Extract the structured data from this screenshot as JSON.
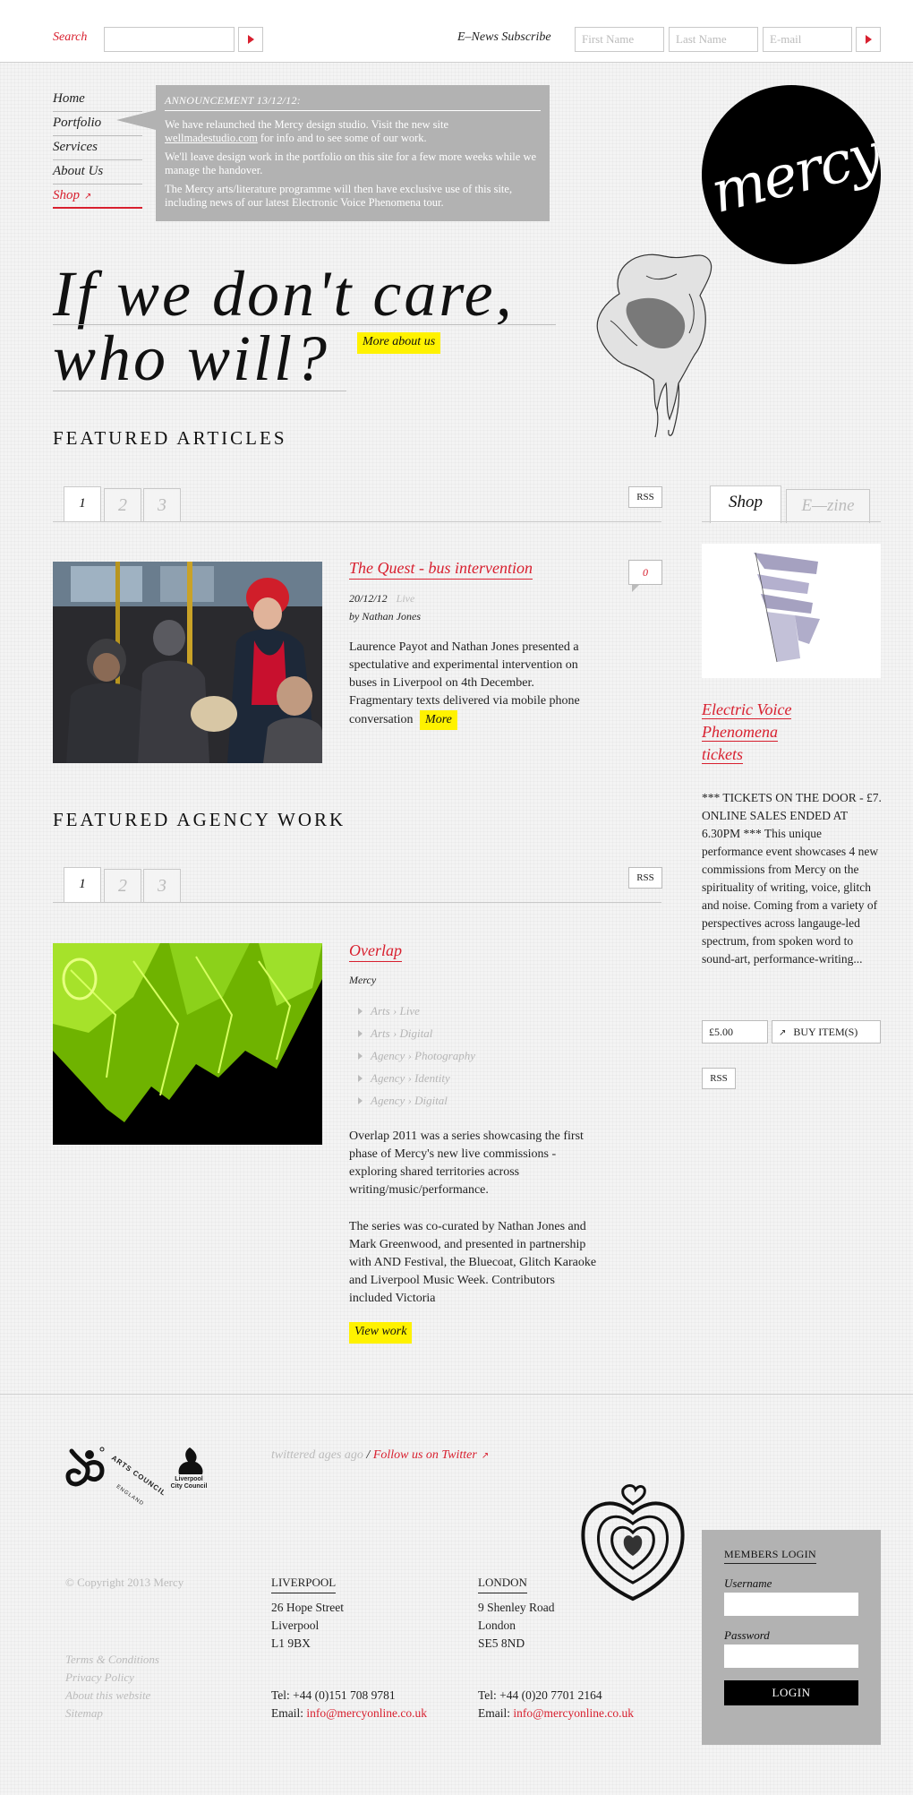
{
  "topbar": {
    "search_label": "Search",
    "enews_label": "E–News Subscribe",
    "first_name_placeholder": "First Name",
    "last_name_placeholder": "Last Name",
    "email_placeholder": "E-mail"
  },
  "nav": {
    "items": [
      {
        "label": "Home"
      },
      {
        "label": "Portfolio"
      },
      {
        "label": "Services"
      },
      {
        "label": "About Us"
      },
      {
        "label": "Shop"
      }
    ]
  },
  "announcement": {
    "title": "ANNOUNCEMENT 13/12/12:",
    "p1_pre": "We have relaunched the Mercy design studio. Visit the new site ",
    "p1_link": "wellmadestudio.com",
    "p1_post": " for info and to see some of our work.",
    "p2": "We'll leave design work in the portfolio on this site for a few more weeks while we manage the handover.",
    "p3": "The Mercy arts/literature programme will then have exclusive use of this site, including news of our latest Electronic Voice Phenomena tour."
  },
  "logo": {
    "text": "mercy"
  },
  "hero": {
    "line1": "If we don't care,",
    "line2": "who will?",
    "more_button": "More about us"
  },
  "featured_articles": {
    "heading": "FEATURED ARTICLES",
    "tabs": [
      "1",
      "2",
      "3"
    ],
    "rss": "RSS",
    "article": {
      "title": "The Quest - bus intervention",
      "date": "20/12/12",
      "category": "Live",
      "author": "by Nathan Jones",
      "comments": "0",
      "body": "Laurence Payot and Nathan Jones presented a spectulative and experimental intervention on buses in Liverpool on 4th December. Fragmentary texts delivered via mobile phone conversation",
      "more": "More"
    }
  },
  "featured_work": {
    "heading": "FEATURED AGENCY WORK",
    "tabs": [
      "1",
      "2",
      "3"
    ],
    "rss": "RSS",
    "work": {
      "title": "Overlap",
      "client": "Mercy",
      "tags": [
        "Arts › Live",
        "Arts › Digital",
        "Agency › Photography",
        "Agency › Identity",
        "Agency › Digital"
      ],
      "body1": "Overlap 2011 was a series showcasing the first phase of Mercy's new live commissions - exploring shared territories across writing/music/performance.",
      "body2": "The series was co-curated by Nathan Jones and Mark Greenwood, and presented in partnership with AND Festival, the Bluecoat, Glitch Karaoke and Liverpool Music Week. Contributors included Victoria",
      "view": "View work"
    }
  },
  "sidebar": {
    "tabs": [
      "Shop",
      "E—zine"
    ],
    "product": {
      "title_lines": [
        "Electric Voice",
        "Phenomena",
        "tickets"
      ],
      "description": "*** TICKETS ON THE DOOR - £7. ONLINE SALES ENDED AT 6.30PM *** This unique performance event showcases 4 new commissions from Mercy on the spirituality of writing, voice, glitch and noise. Coming from a variety of perspectives across langauge-led spectrum, from spoken word to sound-art, performance-writing...",
      "price": "£5.00",
      "buy": "BUY ITEM(S)",
      "rss": "RSS"
    }
  },
  "footer": {
    "logos": {
      "arts_council": "ARTS COUNCIL",
      "england": "ENGLAND",
      "liverpool_1": "Liverpool",
      "liverpool_2": "City Council"
    },
    "twitter_status": "twittered ages ago",
    "twitter_sep": "/",
    "twitter_follow": "Follow us on Twitter",
    "copyright": "© Copyright 2013 Mercy",
    "links": [
      "Terms & Conditions",
      "Privacy Policy",
      "About this website",
      "Sitemap"
    ],
    "liverpool": {
      "head": "LIVERPOOL",
      "lines": [
        "26 Hope Street",
        "Liverpool",
        "L1 9BX"
      ],
      "tel": "Tel: +44 (0)151 708 9781",
      "email_label": "Email: ",
      "email": "info@mercyonline.co.uk"
    },
    "london": {
      "head": "LONDON",
      "lines": [
        "9 Shenley Road",
        "London",
        "SE5 8ND"
      ],
      "tel": "Tel: +44 (0)20 7701 2164",
      "email_label": "Email: ",
      "email": "info@mercyonline.co.uk"
    },
    "members": {
      "heading": "MEMBERS LOGIN",
      "username": "Username",
      "password": "Password",
      "login": "LOGIN"
    }
  },
  "colors": {
    "accent_red": "#d8202f",
    "highlight_yellow": "#fff200",
    "panel_grey": "#b2b2b2"
  }
}
